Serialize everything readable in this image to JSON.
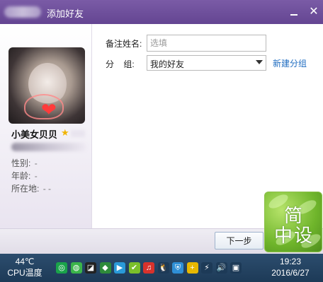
{
  "window": {
    "title": "添加好友",
    "close_glyph": "✕"
  },
  "profile": {
    "nickname": "小美女贝贝",
    "star_glyph": "★",
    "gender_label": "性别:",
    "gender_value": "-",
    "age_label": "年龄:",
    "age_value": "-",
    "location_label": "所在地:",
    "location_value": "-  -"
  },
  "form": {
    "remark_label": "备注姓名:",
    "remark_value": "",
    "remark_placeholder": "选填",
    "group_label": "分    组:",
    "group_selected": "我的好友",
    "new_group_link": "新建分组"
  },
  "actions": {
    "next_label": "下一步"
  },
  "logo": {
    "text": "简中设"
  },
  "taskbar": {
    "temperature": "44℃",
    "cpu_label": "CPU温度",
    "time": "19:23",
    "date": "2016/6/27",
    "tray_icons": [
      {
        "name": "qq-music-icon",
        "color": "#1aa34a",
        "glyph": "◎"
      },
      {
        "name": "wechat-icon",
        "color": "#3bb44a",
        "glyph": "◍"
      },
      {
        "name": "nvidia-icon",
        "color": "#222222",
        "glyph": "◪"
      },
      {
        "name": "shield-green-icon",
        "color": "#2e8b3a",
        "glyph": "◆"
      },
      {
        "name": "media-player-icon",
        "color": "#2a9ad8",
        "glyph": "▶"
      },
      {
        "name": "check-icon",
        "color": "#7bbf2a",
        "glyph": "✔"
      },
      {
        "name": "netease-music-icon",
        "color": "#d8322c",
        "glyph": "♫"
      },
      {
        "name": "qq-penguin-icon",
        "color": "#1d3a57",
        "glyph": "🐧"
      },
      {
        "name": "security-shield-icon",
        "color": "#2f8fd6",
        "glyph": "⛨"
      },
      {
        "name": "plus-badge-icon",
        "color": "#e8b800",
        "glyph": "+"
      },
      {
        "name": "network-icon",
        "color": "#1d3a57",
        "glyph": "⚡"
      },
      {
        "name": "volume-icon",
        "color": "#1d3a57",
        "glyph": "🔊"
      },
      {
        "name": "monitor-icon",
        "color": "#1d3a57",
        "glyph": "▣"
      }
    ]
  },
  "colors": {
    "titlebar": "#6d4f9c",
    "link": "#1f6cc0",
    "taskbar": "#1d3a57",
    "logo_green": "#6fb52b"
  }
}
